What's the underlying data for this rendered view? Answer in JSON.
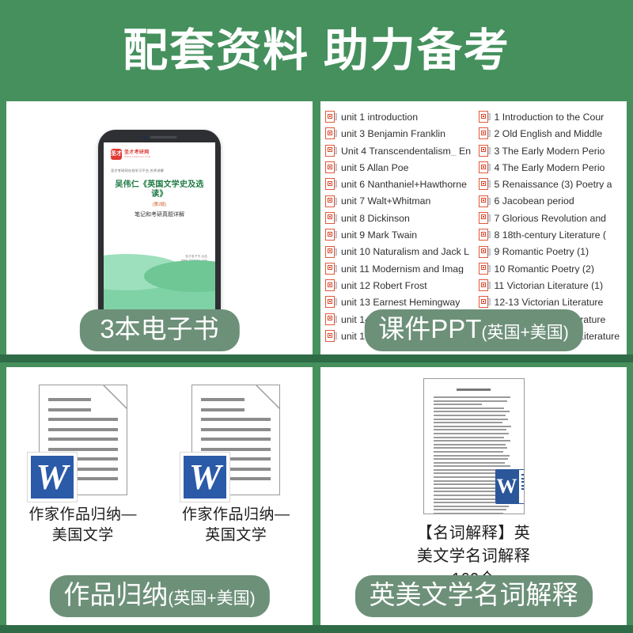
{
  "header": {
    "title": "配套资料 助力备考"
  },
  "theme": {
    "header_green": "#45905d",
    "band_green": "#2f6b46",
    "pill_green": "#6d9079",
    "ppt_icon_red": "#e05a3c",
    "word_blue": "#2a5aa8"
  },
  "cards": {
    "ebook": {
      "pill_main": "3本电子书",
      "pill_sub": "",
      "cover": {
        "brand_badge": "圣才",
        "brand_line1": "圣才考研网",
        "brand_line2": "WWW.100EXAM.COM",
        "series": "圣才考研网在线学习平台 名师讲解",
        "title": "吴伟仁《英国文学史及选读》",
        "edition": "(第2版)",
        "subtitle": "笔记和考研真题详解",
        "footer_line1": "圣才电子书 出品",
        "footer_line2": "www.100eshu.com"
      }
    },
    "ppt": {
      "pill_main": "课件PPT",
      "pill_sub": "(英国+美国)",
      "left_column": [
        "unit 1 introduction",
        "unit 3 Benjamin Franklin",
        "Unit 4 Transcendentalism_ En",
        "unit 5 Allan Poe",
        "unit 6 Nanthaniel+Hawthorne",
        "unit 7 Walt+Whitman",
        "unit 8 Dickinson",
        "unit 9 Mark Twain",
        "unit 10 Naturalism and Jack L",
        "unit 11 Modernism and Imag",
        "unit 12 Robert Frost",
        "unit 13 Earnest Hemingway",
        "unit 14 William Faulkner",
        "unit 15 F.S.Fitzgerald"
      ],
      "right_column": [
        "1 Introduction to the Cour",
        "2 Old English and Middle",
        "3 The Early Modern Perio",
        "4 The Early Modern Perio",
        "5 Renaissance (3) Poetry a",
        "6 Jacobean period",
        "7 Glorious Revolution and",
        "8 18th-century Literature (",
        "9 Romantic Poetry (1)",
        "10 Romantic Poetry (2)",
        "11 Victorian Literature (1)",
        "12-13 Victorian Literature",
        "14 20th-century Literature",
        "15-16 20th-century Literature"
      ]
    },
    "works": {
      "pill_main": "作品归纳",
      "pill_sub": "(英国+美国)",
      "doc_left_caption": "作家作品归纳—\n美国文学",
      "doc_right_caption": "作家作品归纳—\n英国文学",
      "doc_icon_letter": "W"
    },
    "terms": {
      "pill_main": "英美文学名词解释",
      "pill_sub": "",
      "caption": "【名词解释】英\n美文学名词解释\n160个",
      "doc_icon_letter": "W"
    }
  }
}
